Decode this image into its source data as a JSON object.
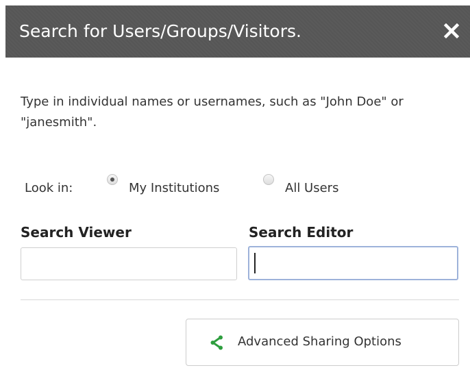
{
  "dialog": {
    "title": "Search for Users/Groups/Visitors.",
    "close_icon": "close-icon"
  },
  "instructions": "Type in individual names or usernames, such as \"John Doe\" or \"janesmith\".",
  "look_in": {
    "label": "Look in:",
    "options": [
      {
        "label": "My Institutions",
        "selected": true
      },
      {
        "label": "All Users",
        "selected": false
      }
    ]
  },
  "fields": {
    "viewer_label": "Search Viewer",
    "viewer_value": "",
    "editor_label": "Search Editor",
    "editor_value": ""
  },
  "advanced_button": {
    "label": "Advanced Sharing Options",
    "icon": "share-icon",
    "icon_color": "#2e9e3e"
  },
  "colors": {
    "titlebar": "#565656",
    "focus_border": "#9db2da"
  }
}
